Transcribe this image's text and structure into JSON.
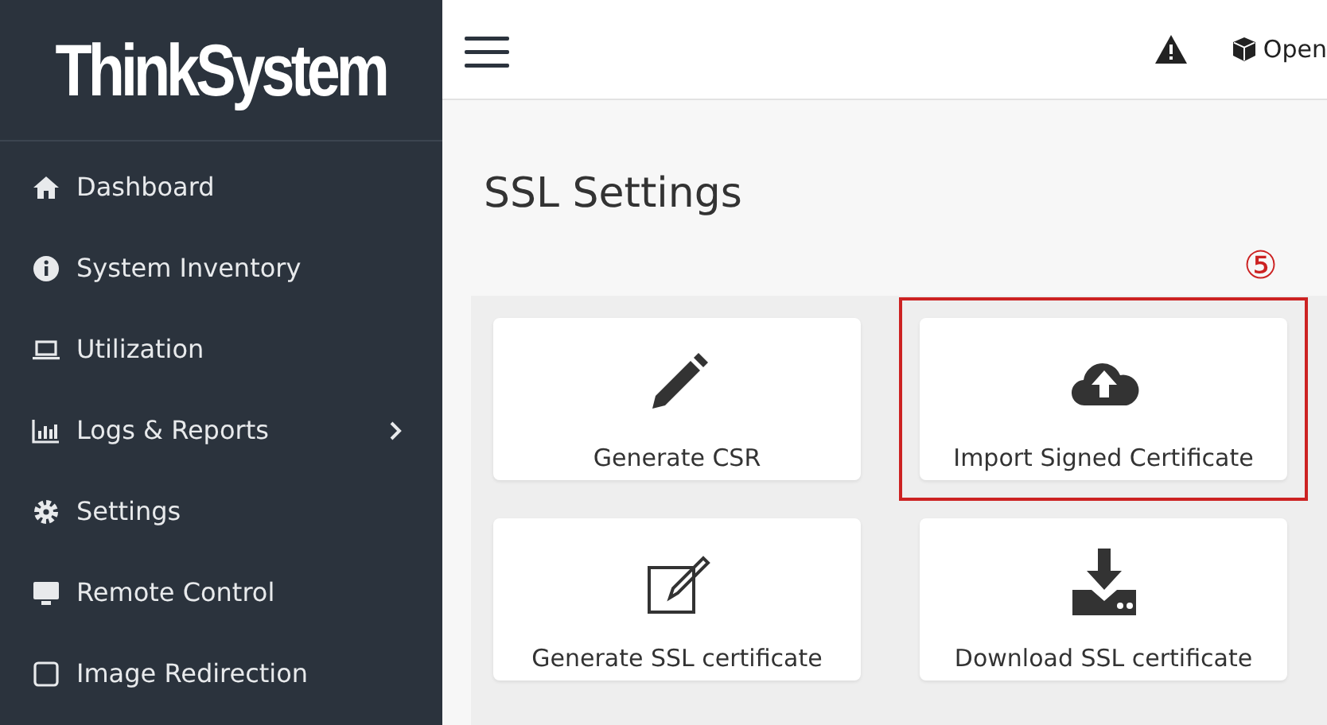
{
  "sidebar": {
    "logo": "ThinkSystem",
    "items": [
      {
        "label": "Dashboard",
        "kind": "home",
        "has_submenu": false
      },
      {
        "label": "System Inventory",
        "kind": "info",
        "has_submenu": false
      },
      {
        "label": "Utilization",
        "kind": "laptop",
        "has_submenu": false
      },
      {
        "label": "Logs & Reports",
        "kind": "chart",
        "has_submenu": true
      },
      {
        "label": "Settings",
        "kind": "gear",
        "has_submenu": false
      },
      {
        "label": "Remote Control",
        "kind": "monitor",
        "has_submenu": false
      },
      {
        "label": "Image Redirection",
        "kind": "disk",
        "has_submenu": false
      }
    ]
  },
  "topbar": {
    "open_label": "Open"
  },
  "page": {
    "title": "SSL Settings",
    "callout": "⑤",
    "cards": [
      {
        "label": "Generate CSR",
        "kind": "pencil",
        "highlighted": false
      },
      {
        "label": "Import Signed Certificate",
        "kind": "upload",
        "highlighted": true
      },
      {
        "label": "Generate SSL certificate",
        "kind": "edit",
        "highlighted": false
      },
      {
        "label": "Download SSL certificate",
        "kind": "download",
        "highlighted": false
      }
    ]
  }
}
